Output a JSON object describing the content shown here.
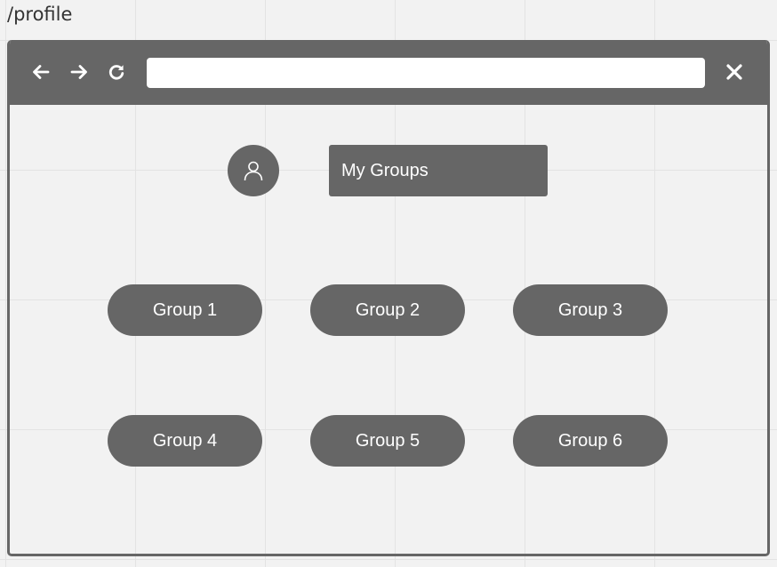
{
  "page": {
    "route": "/profile"
  },
  "browser": {
    "address_value": "",
    "back_icon": "arrow-left-icon",
    "forward_icon": "arrow-right-icon",
    "reload_icon": "reload-icon",
    "close_icon": "close-icon"
  },
  "profile": {
    "avatar_icon": "user-icon",
    "my_groups_label": "My Groups"
  },
  "groups": [
    {
      "label": "Group 1"
    },
    {
      "label": "Group 2"
    },
    {
      "label": "Group 3"
    },
    {
      "label": "Group 4"
    },
    {
      "label": "Group 5"
    },
    {
      "label": "Group 6"
    }
  ],
  "colors": {
    "chrome": "#666666",
    "background": "#f2f2f2",
    "button_text": "#ffffff"
  }
}
